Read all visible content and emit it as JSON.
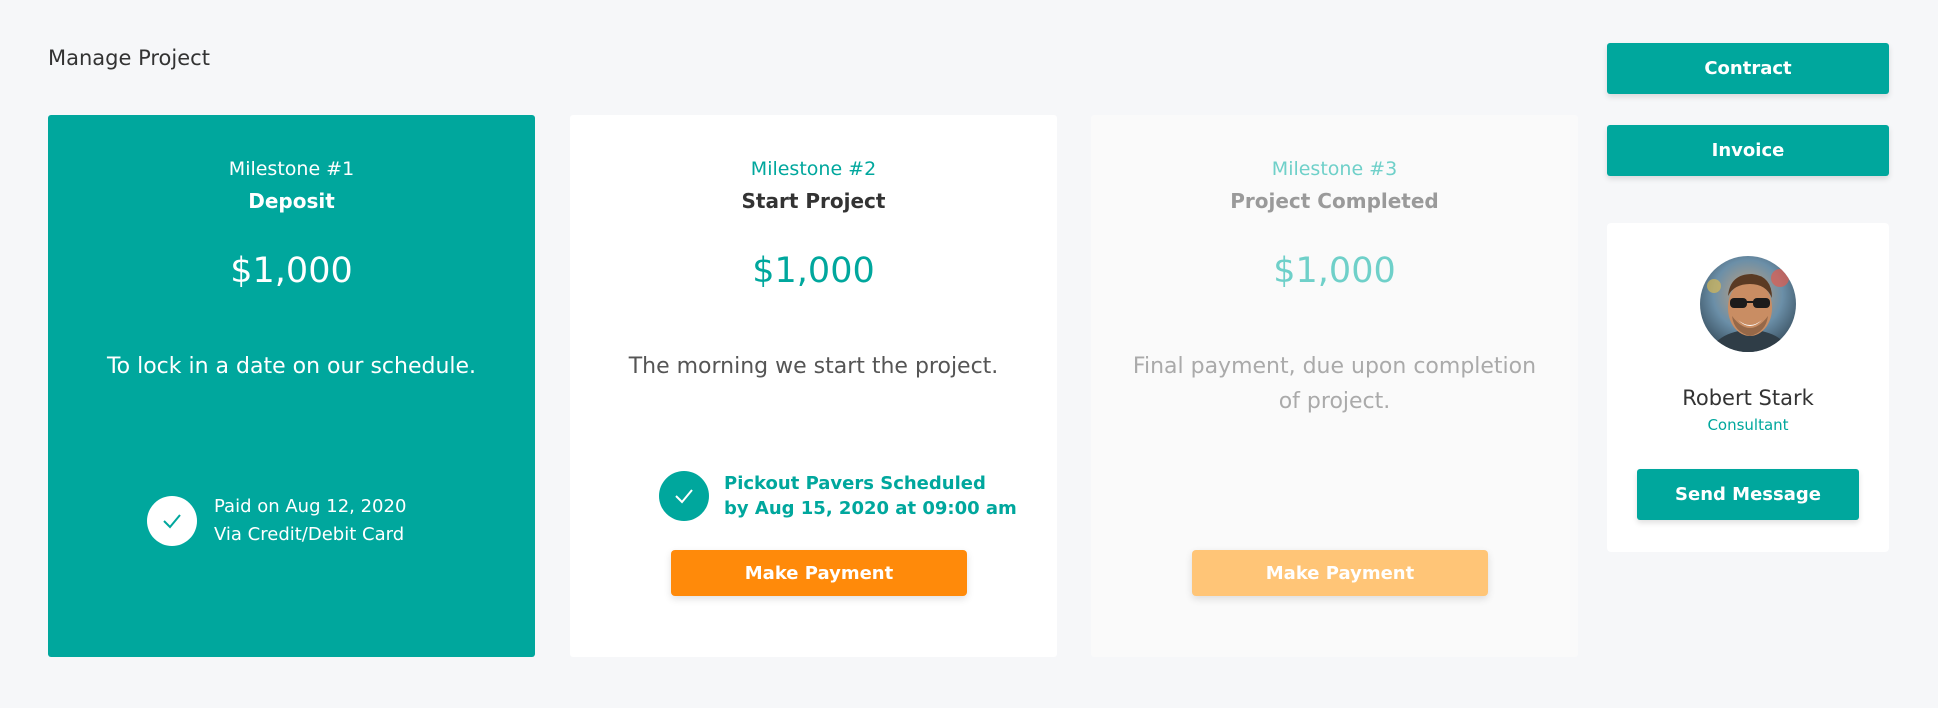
{
  "page": {
    "title": "Manage Project"
  },
  "milestones": [
    {
      "number": "Milestone #1",
      "name": "Deposit",
      "amount": "$1,000",
      "description": "To lock in a date on our schedule.",
      "paid_line1": "Paid on Aug 12, 2020",
      "paid_line2": "Via Credit/Debit Card"
    },
    {
      "number": "Milestone #2",
      "name": "Start Project",
      "amount": "$1,000",
      "description": "The morning we start the project.",
      "schedule_line1": "Pickout Pavers Scheduled",
      "schedule_line2": "by Aug 15, 2020 at 09:00 am",
      "button_label": "Make Payment"
    },
    {
      "number": "Milestone #3",
      "name": "Project Completed",
      "amount": "$1,000",
      "description": "Final payment, due upon completion of project.",
      "button_label": "Make Payment"
    }
  ],
  "actions": {
    "contract_label": "Contract",
    "invoice_label": "Invoice"
  },
  "profile": {
    "name": "Robert Stark",
    "role": "Consultant",
    "message_label": "Send Message"
  },
  "icons": {
    "check": "check-icon",
    "avatar": "avatar-photo"
  },
  "colors": {
    "teal": "#00a79d",
    "orange": "#ff8a0a",
    "orange_disabled": "#ffc577",
    "background": "#f6f7f9"
  }
}
